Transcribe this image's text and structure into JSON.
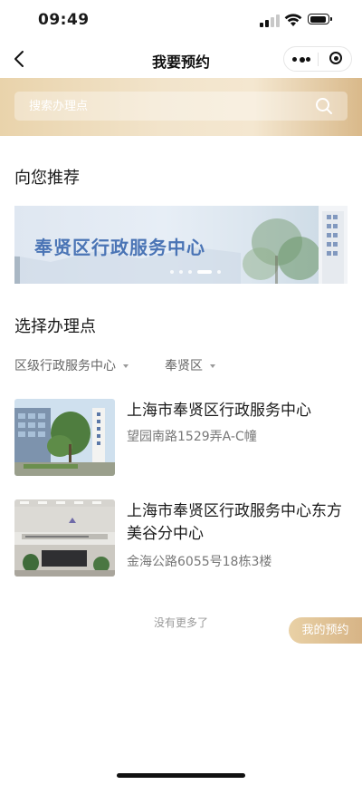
{
  "status_bar": {
    "time": "09:49"
  },
  "nav": {
    "title": "我要预约"
  },
  "search": {
    "placeholder": "搜索办理点"
  },
  "recommend": {
    "title": "向您推荐",
    "banner_text": "奉贤区行政服务中心",
    "slide_count": 5,
    "active_slide": 4
  },
  "select": {
    "title": "选择办理点",
    "filters": [
      {
        "label": "区级行政服务中心"
      },
      {
        "label": "奉贤区"
      }
    ]
  },
  "offices": [
    {
      "name": "上海市奉贤区行政服务中心",
      "address": "望园南路1529弄A-C幢"
    },
    {
      "name": "上海市奉贤区行政服务中心东方美谷分中心",
      "address": "金海公路6055号18栋3楼"
    }
  ],
  "list_footer": "没有更多了",
  "my_appointments_label": "我的预约",
  "colors": {
    "header_gold": "#e9d3ab",
    "banner_blue": "#4a74b5",
    "button_gold": "#d7b486"
  }
}
